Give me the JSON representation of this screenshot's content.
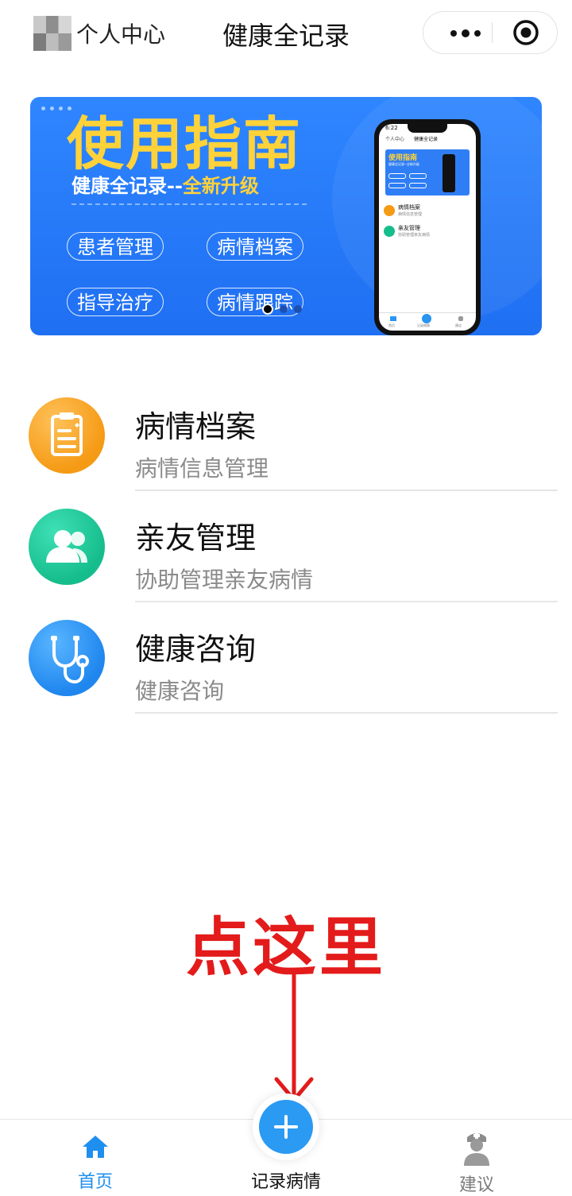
{
  "nav": {
    "user_label": "个人中心",
    "title": "健康全记录",
    "more_icon": "more-dots-icon",
    "close_icon": "miniprogram-close-icon"
  },
  "banner": {
    "title": "使用指南",
    "subtitle_main": "健康全记录--",
    "subtitle_highlight": "全新升级",
    "pills": [
      "患者管理",
      "病情档案",
      "指导治疗",
      "病情跟踪"
    ],
    "accent": "#ffd23a",
    "background": "#2f86ff",
    "phone": {
      "time": "6:22",
      "nav_left": "个人中心",
      "nav_title": "健康全记录",
      "banner_title": "使用指南",
      "banner_subtitle": "健康全记录--全新升级",
      "items": [
        {
          "title": "病情档案",
          "subtitle": "病情信息管理"
        },
        {
          "title": "亲友管理",
          "subtitle": "协助管理亲友病情"
        }
      ],
      "tabs": [
        "首页",
        "记录病情",
        "建议"
      ]
    }
  },
  "menu": [
    {
      "title": "病情档案",
      "subtitle": "病情信息管理",
      "icon": "clipboard-icon",
      "color": "#f59a14"
    },
    {
      "title": "亲友管理",
      "subtitle": "协助管理亲友病情",
      "icon": "users-icon",
      "color": "#16bd8c"
    },
    {
      "title": "健康咨询",
      "subtitle": "健康咨询",
      "icon": "stethoscope-icon",
      "color": "#1f86ee"
    }
  ],
  "annotation": {
    "text": "点这里",
    "color": "#e31b1b"
  },
  "tabbar": {
    "home": "首页",
    "record": "记录病情",
    "suggest": "建议",
    "active_color": "#1f8fef"
  }
}
